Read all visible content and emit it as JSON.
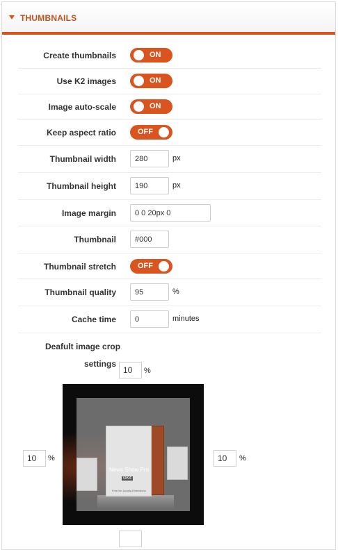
{
  "header": {
    "title": "THUMBNAILS"
  },
  "settings": {
    "create_thumbnails": {
      "label": "Create thumbnails",
      "state": "ON"
    },
    "use_k2_images": {
      "label": "Use K2 images",
      "state": "ON"
    },
    "image_auto_scale": {
      "label": "Image auto-scale",
      "state": "ON"
    },
    "keep_aspect_ratio": {
      "label": "Keep aspect ratio",
      "state": "OFF"
    },
    "thumbnail_width": {
      "label": "Thumbnail width",
      "value": "280",
      "unit": "px"
    },
    "thumbnail_height": {
      "label": "Thumbnail height",
      "value": "190",
      "unit": "px"
    },
    "image_margin": {
      "label": "Image margin",
      "value": "0 0 20px 0"
    },
    "thumbnail_bg": {
      "label": "Thumbnail",
      "value": "#000"
    },
    "thumbnail_stretch": {
      "label": "Thumbnail stretch",
      "state": "OFF"
    },
    "thumbnail_quality": {
      "label": "Thumbnail quality",
      "value": "95",
      "unit": "%"
    },
    "cache_time": {
      "label": "Cache time",
      "value": "0",
      "unit": "minutes"
    }
  },
  "crop": {
    "label_line1": "Deafult image crop",
    "label_line2": "settings",
    "top": "10",
    "left": "10",
    "right": "10",
    "unit": "%",
    "preview": {
      "product_name": "News Show Pro",
      "product_sub": "GK4",
      "product_tag": "Free for Joomla Extensions"
    }
  },
  "colors": {
    "accent": "#d9541e",
    "header_text": "#c4501c"
  }
}
